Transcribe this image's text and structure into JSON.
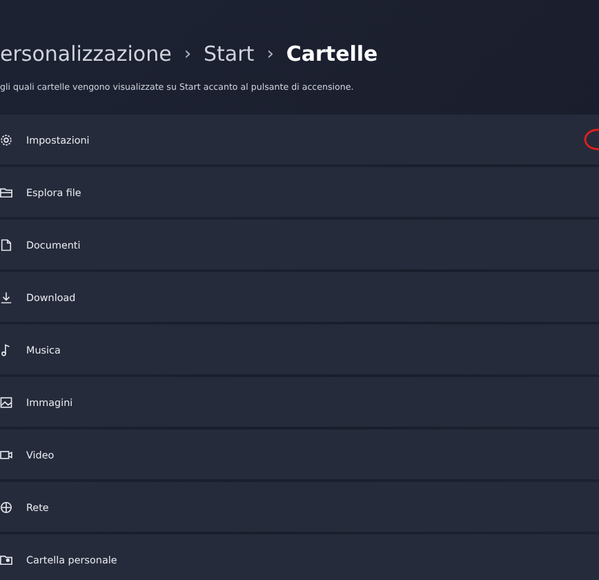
{
  "breadcrumb": [
    {
      "label": "ersonalizzazione",
      "current": false
    },
    {
      "label": "Start",
      "current": false
    },
    {
      "label": "Cartelle",
      "current": true
    }
  ],
  "separator": "›",
  "description": "gli quali cartelle vengono visualizzate su Start accanto al pulsante di accensione.",
  "folders": [
    {
      "label": "Impostazioni",
      "kind": "gear",
      "marked": true
    },
    {
      "label": "Esplora file",
      "kind": "explorer",
      "marked": false
    },
    {
      "label": "Documenti",
      "kind": "document",
      "marked": false
    },
    {
      "label": "Download",
      "kind": "download",
      "marked": false
    },
    {
      "label": "Musica",
      "kind": "music",
      "marked": false
    },
    {
      "label": "Immagini",
      "kind": "image",
      "marked": false
    },
    {
      "label": "Video",
      "kind": "video",
      "marked": false
    },
    {
      "label": "Rete",
      "kind": "network",
      "marked": false
    },
    {
      "label": "Cartella personale",
      "kind": "person",
      "marked": false
    }
  ]
}
